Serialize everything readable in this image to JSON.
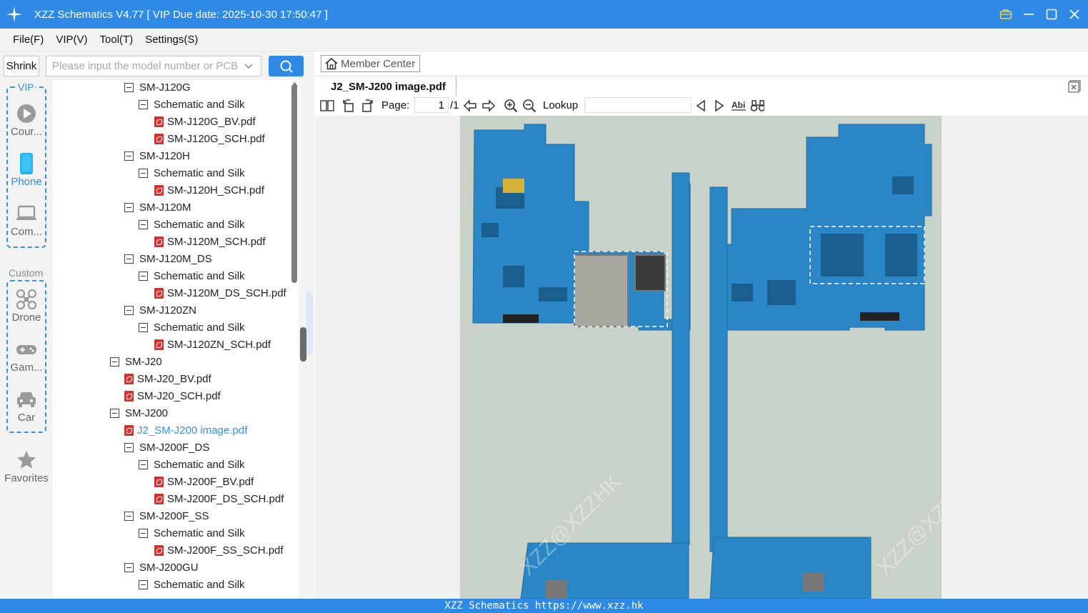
{
  "window": {
    "title": "XZZ Schematics V4.77 [ VIP Due date: 2025-10-30 17:50:47 ]"
  },
  "menu": [
    "File(F)",
    "VIP(V)",
    "Tool(T)",
    "Settings(S)"
  ],
  "search": {
    "shrink_label": "Shrink",
    "placeholder": "Please input the model number or PCB"
  },
  "rail": {
    "vip_label": "VIP",
    "custom_label": "Custom",
    "items": [
      "Cour...",
      "Phone",
      "Com...",
      "Drone",
      "Gam...",
      "Car",
      "Favorites"
    ]
  },
  "tree": [
    {
      "label": "SM-J120G",
      "type": "folder",
      "level": 1
    },
    {
      "label": "Schematic and Silk",
      "type": "folder",
      "level": 2
    },
    {
      "label": "SM-J120G_BV.pdf",
      "type": "pdf",
      "level": 3
    },
    {
      "label": "SM-J120G_SCH.pdf",
      "type": "pdf",
      "level": 3
    },
    {
      "label": "SM-J120H",
      "type": "folder",
      "level": 1
    },
    {
      "label": "Schematic and Silk",
      "type": "folder",
      "level": 2
    },
    {
      "label": "SM-J120H_SCH.pdf",
      "type": "pdf",
      "level": 3
    },
    {
      "label": "SM-J120M",
      "type": "folder",
      "level": 1
    },
    {
      "label": "Schematic and Silk",
      "type": "folder",
      "level": 2
    },
    {
      "label": "SM-J120M_SCH.pdf",
      "type": "pdf",
      "level": 3
    },
    {
      "label": "SM-J120M_DS",
      "type": "folder",
      "level": 1
    },
    {
      "label": "Schematic and Silk",
      "type": "folder",
      "level": 2
    },
    {
      "label": "SM-J120M_DS_SCH.pdf",
      "type": "pdf",
      "level": 3
    },
    {
      "label": "SM-J120ZN",
      "type": "folder",
      "level": 1
    },
    {
      "label": "Schematic and Silk",
      "type": "folder",
      "level": 2
    },
    {
      "label": "SM-J120ZN_SCH.pdf",
      "type": "pdf",
      "level": 3
    },
    {
      "label": "SM-J20",
      "type": "folder",
      "level": 0
    },
    {
      "label": "SM-J20_BV.pdf",
      "type": "pdf",
      "level": 1
    },
    {
      "label": "SM-J20_SCH.pdf",
      "type": "pdf",
      "level": 1
    },
    {
      "label": "SM-J200",
      "type": "folder",
      "level": 0
    },
    {
      "label": "J2_SM-J200 image.pdf",
      "type": "pdf",
      "level": 1,
      "selected": true
    },
    {
      "label": "SM-J200F_DS",
      "type": "folder",
      "level": 1
    },
    {
      "label": "Schematic and Silk",
      "type": "folder",
      "level": 2
    },
    {
      "label": "SM-J200F_BV.pdf",
      "type": "pdf",
      "level": 3
    },
    {
      "label": "SM-J200F_DS_SCH.pdf",
      "type": "pdf",
      "level": 3
    },
    {
      "label": "SM-J200F_SS",
      "type": "folder",
      "level": 1
    },
    {
      "label": "Schematic and Silk",
      "type": "folder",
      "level": 2
    },
    {
      "label": "SM-J200F_SS_SCH.pdf",
      "type": "pdf",
      "level": 3
    },
    {
      "label": "SM-J200GU",
      "type": "folder",
      "level": 1
    },
    {
      "label": "Schematic and Silk",
      "type": "folder",
      "level": 2
    }
  ],
  "viewer": {
    "member_center": "Member Center",
    "doc_tab": "J2_SM-J200 image.pdf",
    "page_label": "Page:",
    "page_current": "1",
    "page_total": "/1",
    "lookup_label": "Lookup",
    "watermark": "XZZ@XZZHK"
  },
  "footer": "XZZ Schematics https://www.xzz.hk",
  "colors": {
    "accent": "#2f8ae6",
    "link": "#3b8ee0",
    "pdf_red": "#d8312f",
    "pcb_blue": "#2a86c4"
  }
}
